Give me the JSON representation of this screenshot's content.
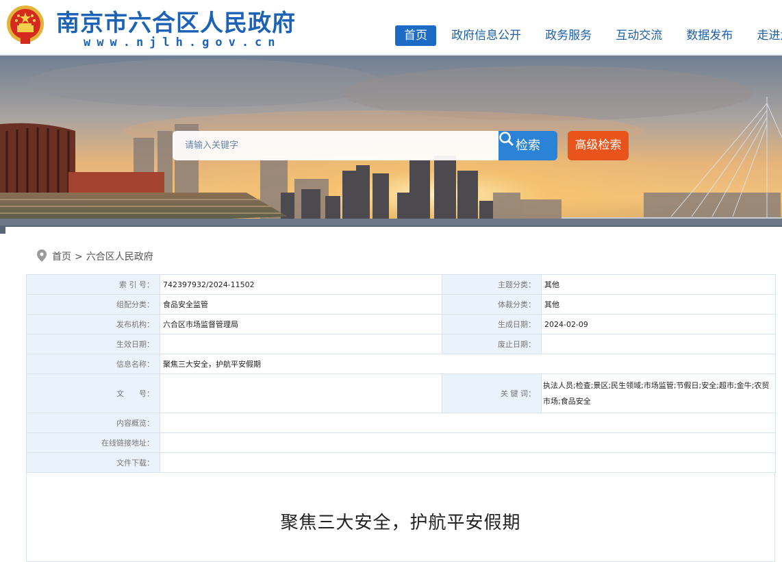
{
  "header": {
    "site_title": "南京市六合区人民政府",
    "site_url": "www.njlh.gov.cn",
    "emblem_icon": "national-emblem-icon",
    "nav": [
      {
        "label": "首页",
        "active": true
      },
      {
        "label": "政府信息公开",
        "active": false
      },
      {
        "label": "政务服务",
        "active": false
      },
      {
        "label": "互动交流",
        "active": false
      },
      {
        "label": "数据发布",
        "active": false
      },
      {
        "label": "走进六合",
        "active": false
      }
    ]
  },
  "search": {
    "placeholder": "请输入关键字",
    "button_label": "检索",
    "button_icon": "search-icon",
    "advanced_label": "高级检索"
  },
  "breadcrumb": {
    "icon": "location-pin-icon",
    "items": [
      "首页",
      "六合区人民政府"
    ],
    "separator": ">"
  },
  "meta": {
    "index_label": "索 引 号：",
    "index_value": "742397932/2024-11502",
    "subject_label": "主题分类：",
    "subject_value": "其他",
    "group_label": "组配分类：",
    "group_value": "食品安全监管",
    "genre_label": "体裁分类：",
    "genre_value": "其他",
    "publisher_label": "发布机构：",
    "publisher_value": "六合区市场监督管理局",
    "created_label": "生成日期：",
    "created_value": "2024-02-09",
    "effective_label": "生效日期：",
    "effective_value": "",
    "abolished_label": "废止日期：",
    "abolished_value": "",
    "name_label": "信息名称：",
    "name_value": "聚焦三大安全，护航平安假期",
    "docno_label": "文　　号：",
    "docno_value": "",
    "keywords_label": "关 键 词：",
    "keywords_value": "执法人员;检查;景区;民生领域;市场监管;节假日;安全;超市;金牛;农贸市场;食品安全",
    "summary_label": "内容概览：",
    "summary_value": "",
    "link_label": "在线链接地址：",
    "link_value": "",
    "download_label": "文件下载：",
    "download_value": ""
  },
  "article": {
    "title": "聚焦三大安全，护航平安假期"
  },
  "colors": {
    "brand_blue": "#1c63b7",
    "nav_active": "#1c6bc4",
    "search_button": "#2a83d6",
    "advanced_button": "#e8541c",
    "label_bg": "#eaf2fb"
  }
}
